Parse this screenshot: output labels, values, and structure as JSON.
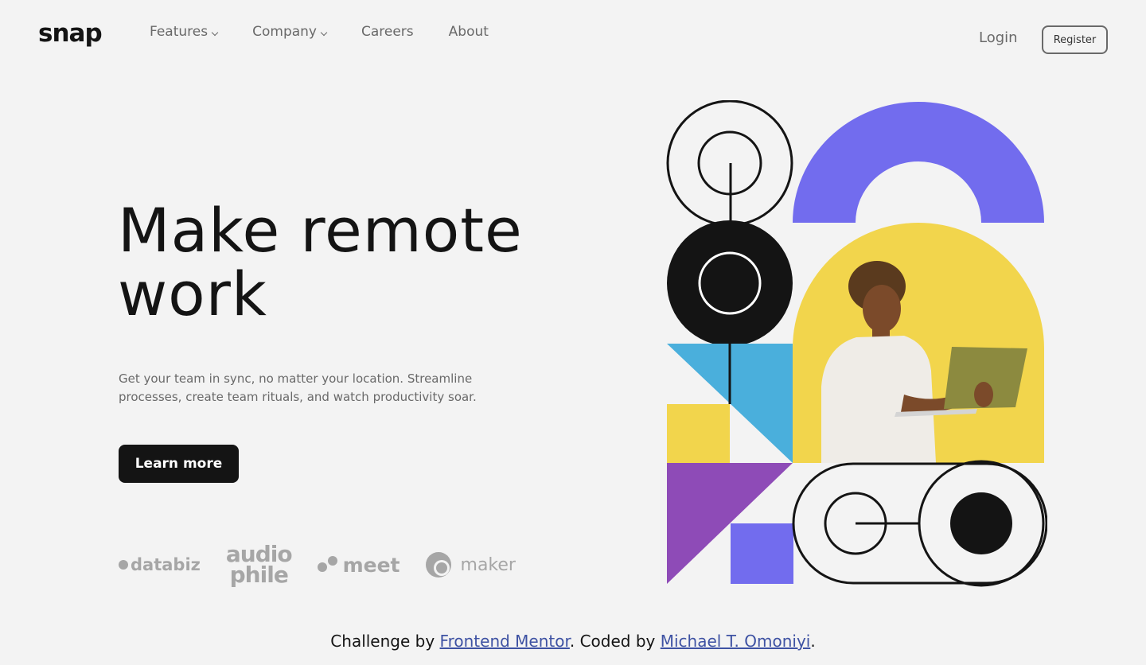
{
  "header": {
    "logo": "snap",
    "nav": [
      {
        "label": "Features",
        "dropdown": true
      },
      {
        "label": "Company",
        "dropdown": true
      },
      {
        "label": "Careers",
        "dropdown": false
      },
      {
        "label": "About",
        "dropdown": false
      }
    ],
    "login_label": "Login",
    "register_label": "Register"
  },
  "hero": {
    "title_line1": "Make remote",
    "title_line2": "work",
    "description": "Get your team in sync, no matter your location. Streamline processes, create team rituals, and watch productivity soar.",
    "cta_label": "Learn more"
  },
  "clients": {
    "databiz": "databiz",
    "audiophile_top": "audio",
    "audiophile_bottom": "phile",
    "meet": "meet",
    "maker": "maker"
  },
  "footer": {
    "prefix": "Challenge by ",
    "link1": "Frontend Mentor",
    "middle": ". Coded by ",
    "link2": "Michael T. Omoniyi",
    "suffix": "."
  },
  "colors": {
    "background": "#f3f3f3",
    "primary": "#141414",
    "muted": "#696969",
    "purple": "#726cee",
    "yellow": "#f2d54c",
    "blue": "#4aafdc",
    "violet": "#8e4bb7"
  }
}
